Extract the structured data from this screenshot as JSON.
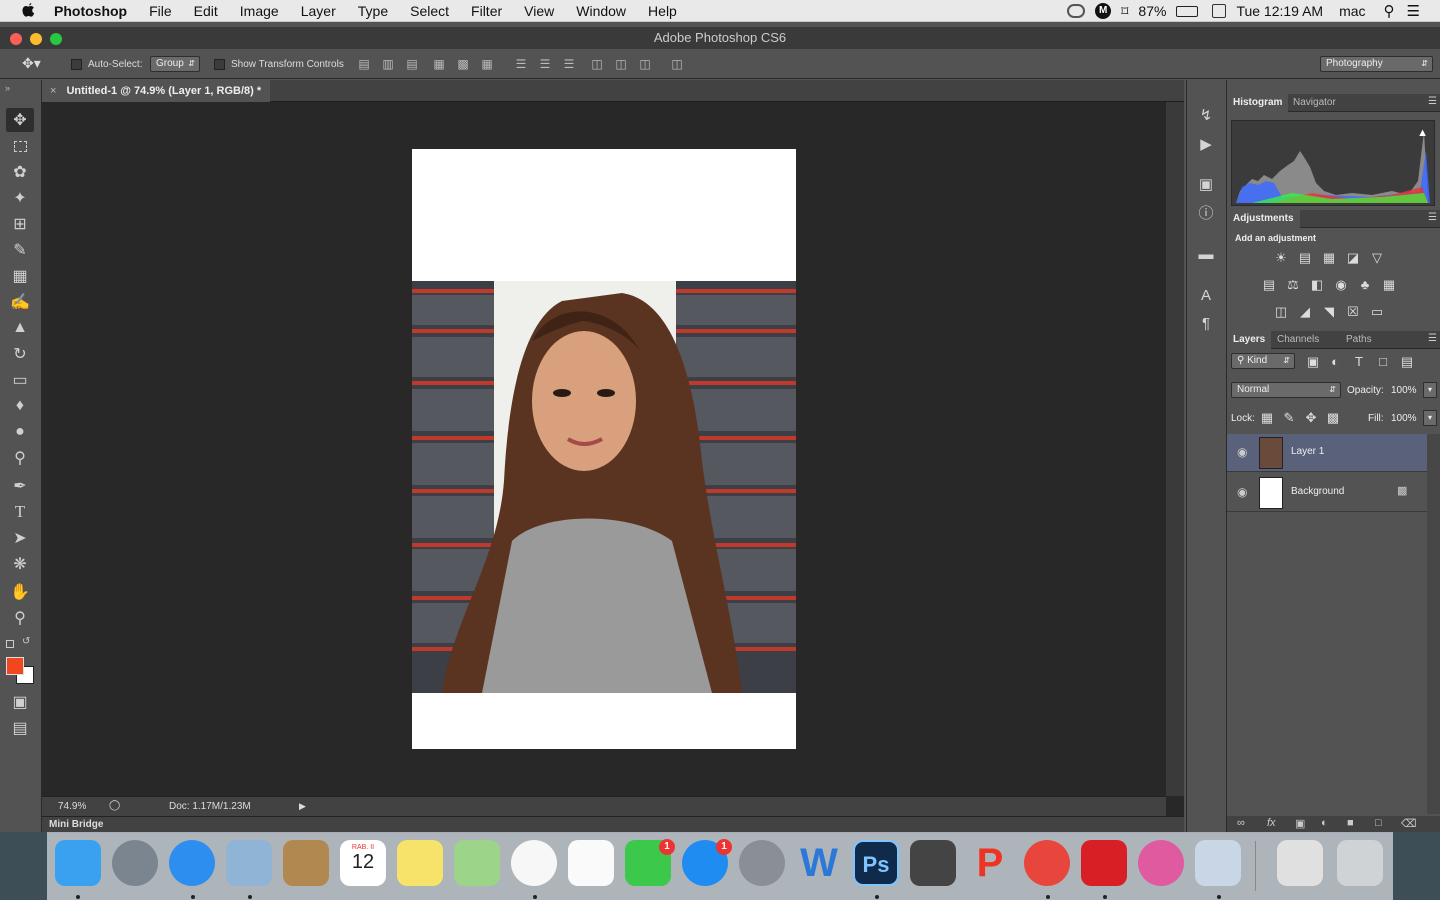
{
  "menubar": {
    "app_name": "Photoshop",
    "items": [
      "File",
      "Edit",
      "Image",
      "Layer",
      "Type",
      "Select",
      "Filter",
      "View",
      "Window",
      "Help"
    ],
    "battery": "87%",
    "clock": "Tue 12:19 AM",
    "user": "mac"
  },
  "window": {
    "title": "Adobe Photoshop CS6"
  },
  "options": {
    "auto_select_label": "Auto-Select:",
    "auto_select_value": "Group",
    "transform_label": "Show Transform Controls",
    "workspace": "Photography"
  },
  "document": {
    "tab_title": "Untitled-1 @ 74.9% (Layer 1, RGB/8) *",
    "zoom": "74.9%",
    "doc_size": "Doc: 1.17M/1.23M",
    "mini_bridge": "Mini Bridge"
  },
  "panels": {
    "histogram_tab": "Histogram",
    "navigator_tab": "Navigator",
    "adjustments_tab": "Adjustments",
    "adjustments_hint": "Add an adjustment",
    "layers_tab": "Layers",
    "channels_tab": "Channels",
    "paths_tab": "Paths",
    "kind": "Kind",
    "blend_mode": "Normal",
    "opacity_label": "Opacity:",
    "opacity_value": "100%",
    "lock_label": "Lock:",
    "fill_label": "Fill:",
    "fill_value": "100%",
    "layers": [
      {
        "name": "Layer 1",
        "selected": true
      },
      {
        "name": "Background",
        "selected": false
      }
    ]
  },
  "colors": {
    "foreground": "#f0471e",
    "background": "#ffffff",
    "accent": "#59627a"
  },
  "dock": {
    "calendar_month": "RAB. II",
    "calendar_day": "12",
    "facetime_badge": "1",
    "appstore_badge": "1"
  }
}
